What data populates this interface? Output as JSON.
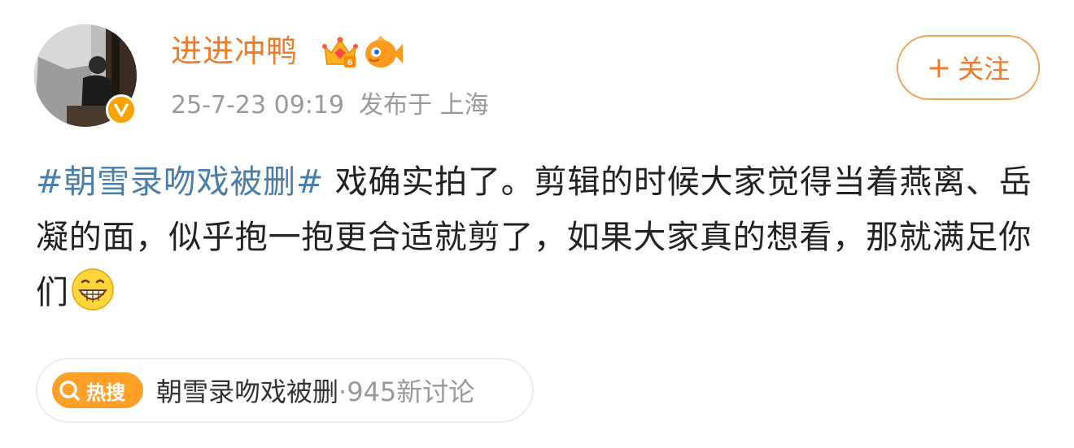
{
  "user": {
    "name": "进进冲鸭",
    "timestamp": "25-7-23 09:19",
    "location": "发布于 上海"
  },
  "follow": {
    "plus": "+",
    "label": "关注"
  },
  "post": {
    "hashtag": "#朝雪录吻戏被删#",
    "text": " 戏确实拍了。剪辑的时候大家觉得当着燕离、岳凝的面，似乎抱一抱更合适就剪了，如果大家真的想看，那就满足你们"
  },
  "hot_search": {
    "badge": "热搜",
    "topic": "朝雪录吻戏被删",
    "count": "·945新讨论"
  },
  "colors": {
    "accent": "#ef7a28",
    "link": "#4a7ea8",
    "badge": "#ffa128"
  }
}
